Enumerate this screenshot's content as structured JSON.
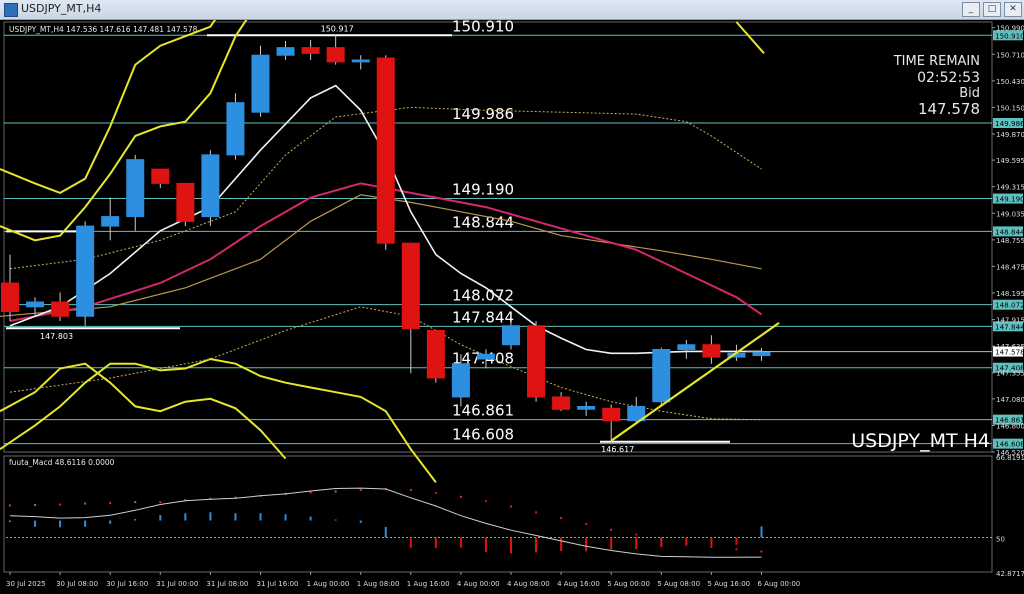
{
  "window": {
    "title": "USDJPY_MT,H4",
    "btn_min": "_",
    "btn_max": "□",
    "btn_close": "✕"
  },
  "chart_data": {
    "type": "candlestick",
    "symbol_label": "USDJPY_MT,H4",
    "ohlc_header": "USDJPY_MT,H4  147.536 147.616 147.481 147.578",
    "watermark": "USDJPY_MT H4",
    "info": {
      "title": "TIME REMAIN",
      "countdown": "02:52:53",
      "bid_label": "Bid",
      "bid": "147.578"
    },
    "y_range": [
      146.52,
      151.05
    ],
    "y_ticks": [
      "150.990",
      "150.710",
      "150.430",
      "150.150",
      "149.870",
      "149.595",
      "149.315",
      "149.035",
      "148.755",
      "148.475",
      "148.195",
      "147.915",
      "147.635",
      "147.355",
      "147.080",
      "146.800",
      "146.520"
    ],
    "levels": [
      {
        "value": 150.91,
        "label": "150.910",
        "tag": "150.910"
      },
      {
        "value": 149.986,
        "label": "149.986",
        "tag": "149.986"
      },
      {
        "value": 149.19,
        "label": "149.190",
        "tag": "149.190"
      },
      {
        "value": 148.844,
        "label": "148.844",
        "tag": "148.844"
      },
      {
        "value": 148.072,
        "label": "148.072",
        "tag": "148.072"
      },
      {
        "value": 147.844,
        "label": "147.844",
        "tag": "147.844"
      },
      {
        "value": 147.408,
        "label": "147.408",
        "tag": "147.408"
      },
      {
        "value": 146.861,
        "label": "146.861",
        "tag": "146.861"
      },
      {
        "value": 146.608,
        "label": "146.608",
        "tag": "146.608"
      }
    ],
    "price_tag": {
      "value": 147.578,
      "label": "147.578"
    },
    "annotations": [
      {
        "text": "150.917",
        "value": 150.917
      },
      {
        "text": "147.803",
        "value": 147.803
      },
      {
        "text": "146.617",
        "value": 146.617
      }
    ],
    "candles": [
      {
        "o": 148.3,
        "h": 148.6,
        "l": 147.9,
        "c": 148.0
      },
      {
        "o": 148.05,
        "h": 148.15,
        "l": 147.95,
        "c": 148.1
      },
      {
        "o": 148.1,
        "h": 148.2,
        "l": 147.9,
        "c": 147.95
      },
      {
        "o": 147.95,
        "h": 148.95,
        "l": 147.85,
        "c": 148.9
      },
      {
        "o": 148.9,
        "h": 149.2,
        "l": 148.75,
        "c": 149.0
      },
      {
        "o": 149.0,
        "h": 149.65,
        "l": 148.85,
        "c": 149.6
      },
      {
        "o": 149.5,
        "h": 149.5,
        "l": 149.3,
        "c": 149.35
      },
      {
        "o": 149.35,
        "h": 149.35,
        "l": 148.9,
        "c": 148.95
      },
      {
        "o": 149.0,
        "h": 149.7,
        "l": 148.9,
        "c": 149.65
      },
      {
        "o": 149.65,
        "h": 150.3,
        "l": 149.6,
        "c": 150.2
      },
      {
        "o": 150.1,
        "h": 150.8,
        "l": 150.05,
        "c": 150.7
      },
      {
        "o": 150.7,
        "h": 150.85,
        "l": 150.65,
        "c": 150.78
      },
      {
        "o": 150.78,
        "h": 150.86,
        "l": 150.65,
        "c": 150.72
      },
      {
        "o": 150.78,
        "h": 150.917,
        "l": 150.6,
        "c": 150.63
      },
      {
        "o": 150.63,
        "h": 150.7,
        "l": 150.55,
        "c": 150.65
      },
      {
        "o": 150.67,
        "h": 150.7,
        "l": 148.65,
        "c": 148.72
      },
      {
        "o": 148.72,
        "h": 148.72,
        "l": 147.35,
        "c": 147.82
      },
      {
        "o": 147.8,
        "h": 147.8,
        "l": 147.25,
        "c": 147.3
      },
      {
        "o": 147.1,
        "h": 147.55,
        "l": 147.0,
        "c": 147.45
      },
      {
        "o": 147.5,
        "h": 147.6,
        "l": 147.4,
        "c": 147.55
      },
      {
        "o": 147.65,
        "h": 147.9,
        "l": 147.6,
        "c": 147.85
      },
      {
        "o": 147.85,
        "h": 147.9,
        "l": 147.05,
        "c": 147.1
      },
      {
        "o": 147.1,
        "h": 147.15,
        "l": 146.95,
        "c": 146.97
      },
      {
        "o": 146.97,
        "h": 147.05,
        "l": 146.9,
        "c": 147.0
      },
      {
        "o": 146.98,
        "h": 147.02,
        "l": 146.617,
        "c": 146.85
      },
      {
        "o": 146.85,
        "h": 147.1,
        "l": 146.83,
        "c": 147.0
      },
      {
        "o": 147.05,
        "h": 147.62,
        "l": 147.0,
        "c": 147.6
      },
      {
        "o": 147.6,
        "h": 147.7,
        "l": 147.5,
        "c": 147.65
      },
      {
        "o": 147.65,
        "h": 147.75,
        "l": 147.45,
        "c": 147.52
      },
      {
        "o": 147.52,
        "h": 147.65,
        "l": 147.48,
        "c": 147.56
      },
      {
        "o": 147.536,
        "h": 147.616,
        "l": 147.481,
        "c": 147.578
      }
    ],
    "x_ticks": [
      "30 Jul 2025",
      "30 Jul 08:00",
      "30 Jul 16:00",
      "31 Jul 00:00",
      "31 Jul 08:00",
      "31 Jul 16:00",
      "1 Aug 00:00",
      "1 Aug 08:00",
      "1 Aug 16:00",
      "4 Aug 00:00",
      "4 Aug 08:00",
      "4 Aug 16:00",
      "5 Aug 00:00",
      "5 Aug 08:00",
      "5 Aug 16:00",
      "6 Aug 00:00"
    ],
    "macd": {
      "label": "fuuta_Macd 48.6116  0.0000",
      "y_ticks": [
        "66.8191",
        "50",
        "42.8717"
      ],
      "y_range": [
        42.8717,
        66.8191
      ],
      "zero": 50
    }
  },
  "colors": {
    "bull": "#2d8fe0",
    "bear": "#e01313",
    "level": "#5fc0c0",
    "yellow": "#e6e62a",
    "white": "#f2f2f2",
    "magenta": "#d5266f",
    "tan": "#b89a4c",
    "grid": "#777"
  }
}
